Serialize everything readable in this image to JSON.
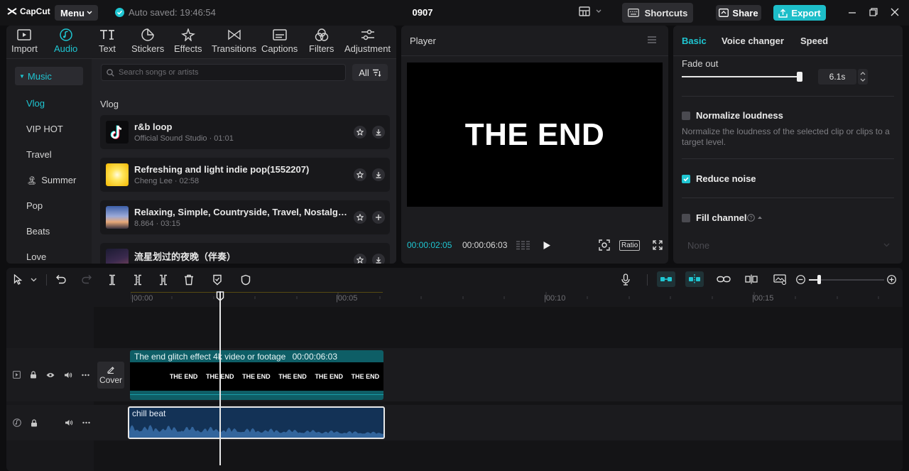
{
  "app": {
    "logo_text": "CapCut",
    "menu_label": "Menu",
    "autosave": "Auto saved: 19:46:54",
    "project_title": "0907",
    "shortcuts_label": "Shortcuts",
    "share_label": "Share",
    "export_label": "Export",
    "accent_color": "#1fc6d2"
  },
  "toolbar": {
    "tabs": [
      {
        "label": "Import",
        "icon": "import-icon"
      },
      {
        "label": "Audio",
        "icon": "audio-icon",
        "active": true
      },
      {
        "label": "Text",
        "icon": "text-icon"
      },
      {
        "label": "Stickers",
        "icon": "stickers-icon"
      },
      {
        "label": "Effects",
        "icon": "effects-icon"
      },
      {
        "label": "Transitions",
        "icon": "transitions-icon"
      },
      {
        "label": "Captions",
        "icon": "captions-icon"
      },
      {
        "label": "Filters",
        "icon": "filters-icon"
      },
      {
        "label": "Adjustment",
        "icon": "adjustment-icon"
      }
    ]
  },
  "sidebar": {
    "header": "Music",
    "items": [
      "Vlog",
      "VIP HOT",
      "Travel",
      "Summer",
      "Pop",
      "Beats",
      "Love"
    ]
  },
  "library": {
    "search_placeholder": "Search songs or artists",
    "filter_label": "All",
    "section": "Vlog",
    "songs": [
      {
        "title": "r&b loop",
        "meta": "Official Sound Studio · 01:01",
        "action": "download"
      },
      {
        "title": "Refreshing and light indie pop(1552207)",
        "meta": "Cheng Lee · 02:58",
        "action": "download"
      },
      {
        "title": "Relaxing, Simple, Countryside, Travel, Nostalgic...",
        "meta": "8.864 · 03:15",
        "action": "add"
      },
      {
        "title": "流星划过的夜晚（伴奏）",
        "meta": "",
        "action": "download"
      }
    ]
  },
  "player": {
    "title": "Player",
    "screen_text": "THE END",
    "current_time": "00:00:02:05",
    "total_time": "00:00:06:03",
    "ratio_label": "Ratio"
  },
  "properties": {
    "tabs": [
      "Basic",
      "Voice changer",
      "Speed"
    ],
    "fade_out_label": "Fade out",
    "fade_out_value": "6.1s",
    "fade_out_level": 0.98,
    "normalize_label": "Normalize loudness",
    "normalize_desc": "Normalize the loudness of the selected clip or clips to a target level.",
    "reduce_noise_label": "Reduce noise",
    "fill_channel_label": "Fill channel",
    "fill_channel_value": "None"
  },
  "timeline": {
    "ruler": [
      "|00:00",
      "|00:05",
      "|00:10",
      "|00:15"
    ],
    "video_clip": {
      "label": "The end glitch effect 4k video or footage",
      "duration": "00:00:06:03",
      "frames": [
        "THE END",
        "THE END",
        "THE END",
        "THE END",
        "THE END",
        "THE END"
      ]
    },
    "audio_clip": {
      "label": "chill beat"
    },
    "cover_label": "Cover"
  }
}
